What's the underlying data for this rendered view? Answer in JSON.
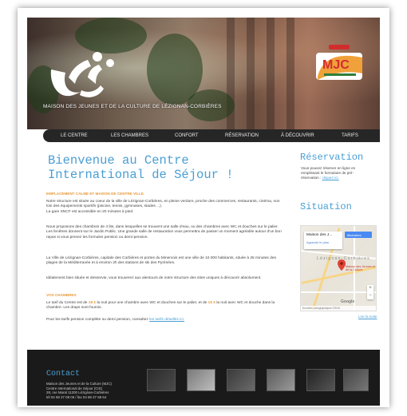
{
  "header": {
    "caption": "MAISON DES JEUNES ET DE LA CULTURE DE LÉZIGNAN-CORBIÈRES",
    "mjc_logo_text": "MJC"
  },
  "nav": {
    "items": [
      "LE CENTRE",
      "LES CHAMBRES",
      "CONFORT",
      "RÉSERVATION",
      "À DÉCOUVRIR",
      "TARIFS"
    ]
  },
  "main": {
    "title_line1": "Bienvenue au Centre",
    "title_line2": "International de Séjour !",
    "subhead1": "EMPLACEMENT CALME ET MAISON DE CENTRE VILLE",
    "p1": "Notre structure est située au coeur de la ville de Lézignan-Corbières, en pleine verdure, proche des commerces, restaurants, cinéma, non loin des équipements sportifs (piscine, tennis, gymnases, stades ...).",
    "p1b": "La gare SNCF est accessible en 20 minutes à pied.",
    "p2": "Nous proposons des chambres de 4 lits, dans lesquelles se trouvent une salle d'eau, ou des chambres avec WC et douches sur le palier. Les fenêtres donnent sur le Jardin Public. Une grande salle de restauration vous permettra de passer un moment agréable autour d'un bon repas si vous prenez les formules pension ou demi-pension.",
    "p3": "La Ville de Lézignan-Corbières, capitale des Corbières et portes du Minervois est une ville de 10 000 habitants, située à 25 minutes des plages de la Méditerranée et à environ 2h des stations de ski des Pyrénées.",
    "p4": "Idéalement bien située et desservie, vous trouverez aux alentours de notre structure des sites uniques à découvrir absolument.",
    "subhead2": "VOS CHAMBRES",
    "p5_a": "Le tarif du Centre est de ",
    "p5_price1": "18 €",
    "p5_b": " la nuit pour une chambre avec WC et douches sur le palier, et de ",
    "p5_price2": "15 €",
    "p5_c": " la nuit avec WC et douche dans la chambre. Les draps sont fournis.",
    "p6_a": "Pour les tarifs pension complète ou demi pension, consultez ",
    "p6_link": "les tarifs détaillés ici."
  },
  "sidebar": {
    "reservation_title": "Réservation",
    "reservation_text": "Vous pouvez réserver en ligne en remplissant le formulaire de pré-réservation : ",
    "reservation_link": "cliquez ici.",
    "situation_title": "Situation",
    "map_place": "Maison des J...",
    "map_enlarge": "Agrandir le plan",
    "map_directions": "Itinéraires",
    "map_town": "Lézignan-Corbières",
    "map_pin_label": "Maison des Jeunes et de la Culture",
    "map_google": "Google",
    "map_footer": "Données cartographiques ©2015",
    "map_link": "Lire la suite"
  },
  "footer": {
    "title": "Contact",
    "address_lines": [
      "Maison des Jeunes et de la Culture (MJC)",
      "Centre International de Séjour (CIS)",
      "28, rue Maral 11200 Lézignan-Corbières",
      "tél 04 68 27 08 06 / fax 04 68 27 68 64"
    ]
  },
  "colors": {
    "accent_blue": "#4a9fd4",
    "accent_orange": "#e79a3a",
    "nav_bg": "#262626",
    "footer_bg": "#1a1a1a"
  }
}
